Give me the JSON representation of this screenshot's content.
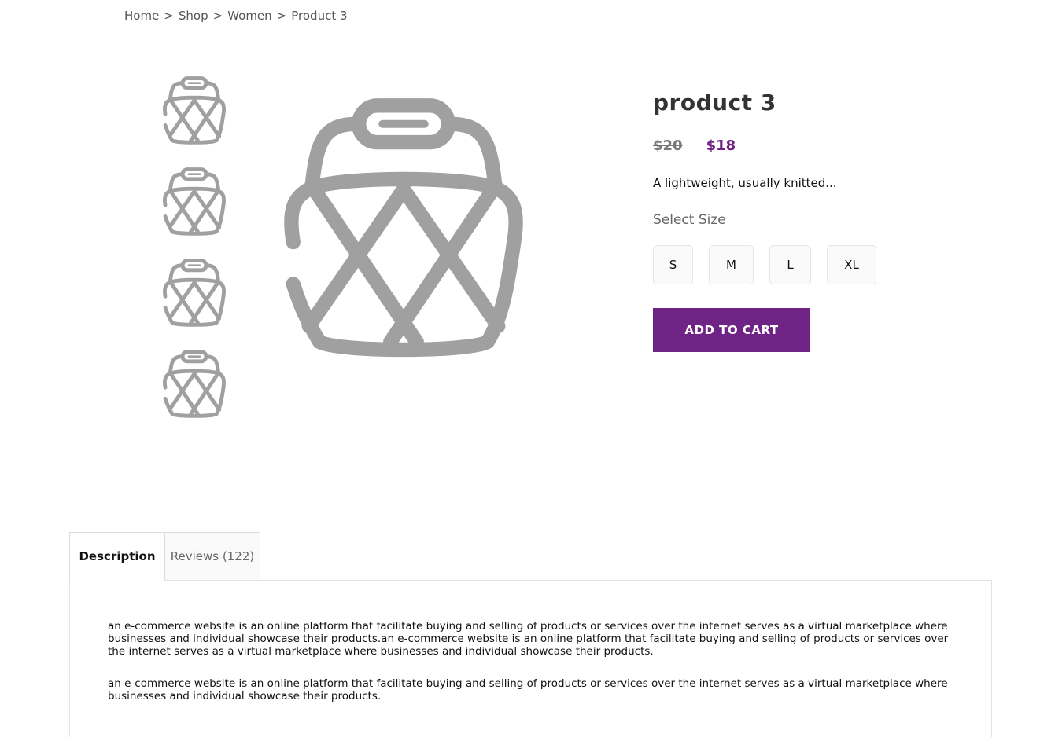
{
  "breadcrumb": {
    "items": [
      "Home",
      "Shop",
      "Women"
    ],
    "current": "Product 3",
    "separator": ">"
  },
  "product": {
    "title": "product 3",
    "old_price": "$20",
    "new_price": "$18",
    "short_description": "A lightweight, usually knitted...",
    "size_label": "Select Size",
    "sizes": [
      "S",
      "M",
      "L",
      "XL"
    ],
    "add_to_cart_label": "ADD TO CART",
    "image_icon": "basket-icon",
    "thumbnail_count": 4
  },
  "tabs": {
    "items": [
      "Description",
      "Reviews (122)"
    ],
    "active": "Description"
  },
  "description": {
    "paragraphs": [
      "an e-commerce website is an online platform that facilitate buying and selling of products or services over the internet serves as a virtual marketplace where businesses and individual showcase their products.an e-commerce website is an online platform that facilitate buying and selling of products or services over the internet serves as a virtual marketplace where businesses and individual showcase their products.",
      "an e-commerce website is an online platform that facilitate buying and selling of products or services over the internet serves as a virtual marketplace where businesses and individual showcase their products."
    ]
  },
  "colors": {
    "accent": "#6f2384",
    "icon_gray": "#a0a0a0"
  }
}
